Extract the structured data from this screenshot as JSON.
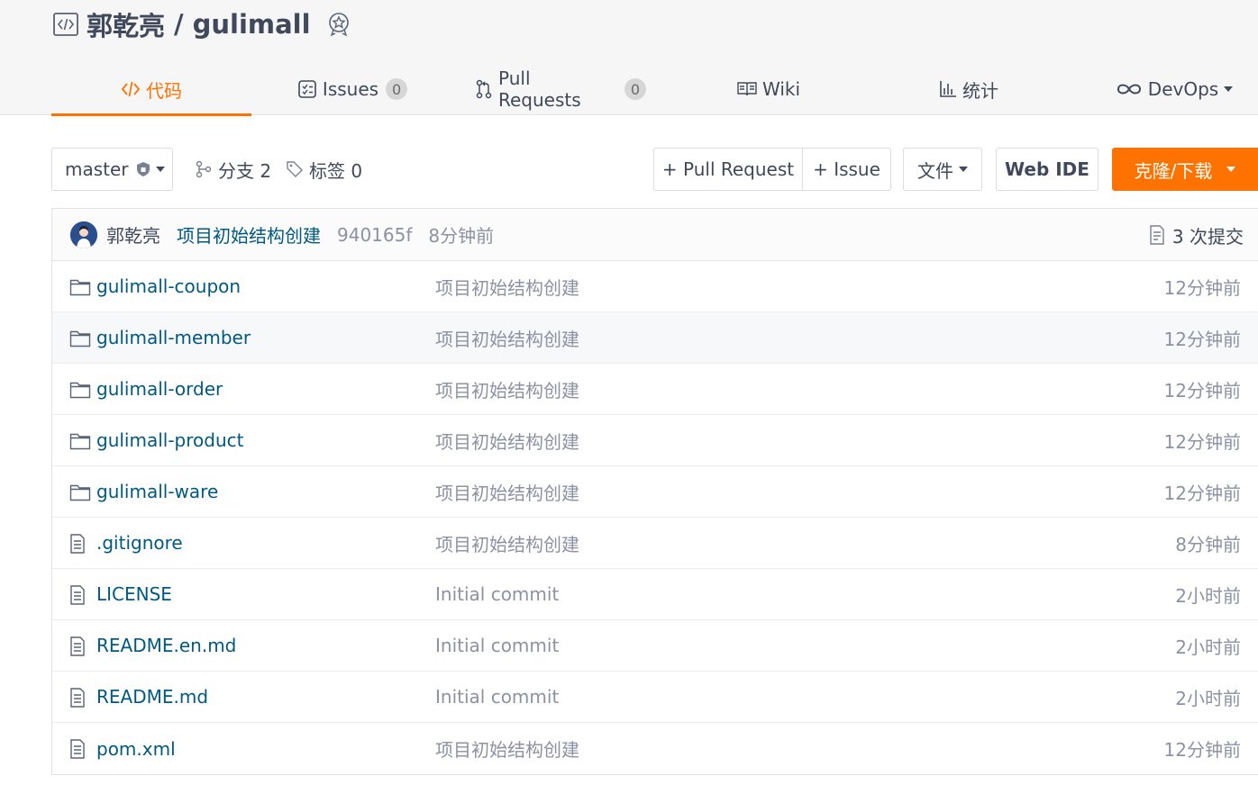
{
  "repo": {
    "owner": "郭乾亮",
    "separator": "/",
    "name": "gulimall"
  },
  "tabs": [
    {
      "label": "代码",
      "icon": "code-icon",
      "active": true
    },
    {
      "label": "Issues",
      "icon": "issues-icon",
      "badge": "0"
    },
    {
      "label": "Pull Requests",
      "icon": "pull-request-icon",
      "badge": "0"
    },
    {
      "label": "Wiki",
      "icon": "book-icon"
    },
    {
      "label": "统计",
      "icon": "bar-chart-icon"
    },
    {
      "label": "DevOps",
      "icon": "infinity-icon"
    }
  ],
  "toolbar": {
    "branch": "master",
    "branches_label": "分支 2",
    "tags_label": "标签 0",
    "pull_request_label": "+ Pull Request",
    "issue_label": "+ Issue",
    "file_label": "文件",
    "web_ide_label": "Web IDE",
    "clone_label": "克隆/下载"
  },
  "latest_commit": {
    "author": "郭乾亮",
    "message": "项目初始结构创建",
    "hash": "940165f",
    "time": "8分钟前",
    "count_label": "3 次提交"
  },
  "files": [
    {
      "name": "gulimall-coupon",
      "type": "folder",
      "message": "项目初始结构创建",
      "time": "12分钟前"
    },
    {
      "name": "gulimall-member",
      "type": "folder",
      "message": "项目初始结构创建",
      "time": "12分钟前"
    },
    {
      "name": "gulimall-order",
      "type": "folder",
      "message": "项目初始结构创建",
      "time": "12分钟前"
    },
    {
      "name": "gulimall-product",
      "type": "folder",
      "message": "项目初始结构创建",
      "time": "12分钟前"
    },
    {
      "name": "gulimall-ware",
      "type": "folder",
      "message": "项目初始结构创建",
      "time": "12分钟前"
    },
    {
      "name": ".gitignore",
      "type": "file",
      "message": "项目初始结构创建",
      "time": "8分钟前"
    },
    {
      "name": "LICENSE",
      "type": "file",
      "message": "Initial commit",
      "time": "2小时前"
    },
    {
      "name": "README.en.md",
      "type": "file",
      "message": "Initial commit",
      "time": "2小时前"
    },
    {
      "name": "README.md",
      "type": "file",
      "message": "Initial commit",
      "time": "2小时前"
    },
    {
      "name": "pom.xml",
      "type": "file",
      "message": "项目初始结构创建",
      "time": "12分钟前"
    }
  ],
  "colors": {
    "accent": "#fe7300",
    "link": "#005980",
    "muted": "#8c92a4",
    "text": "#40485b"
  }
}
